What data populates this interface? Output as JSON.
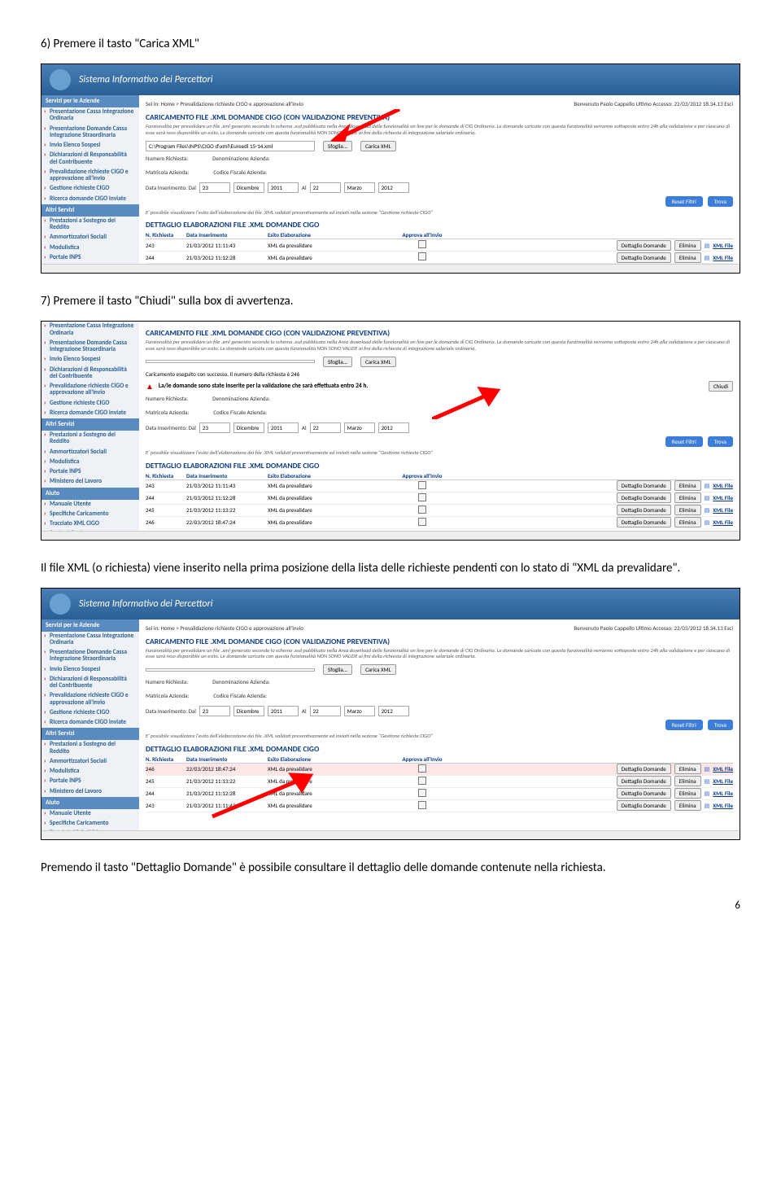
{
  "instr": {
    "six": "6) Premere il tasto \"Carica XML\"",
    "seven": "7) Premere il tasto \"Chiudi\" sulla box di avvertenza.",
    "xml_inserted": "Il file XML (o richiesta) viene inserito nella prima posizione della lista delle richieste pendenti con lo stato di \"XML da prevalidare\".",
    "dettaglio": "Premendo il tasto \"Dettaglio Domande\" è possibile consultare il dettaglio delle domande contenute nella richiesta."
  },
  "app": {
    "banner_title": "Sistema Informativo dei Percettori",
    "breadcrumb_left": "Sei in: Home > Prevalidazione richieste CIGO e approvazione all'invio",
    "breadcrumb_right": "Benvenuto Paolo Cappello   Ultimo Accesso: 22/03/2012 18.34.13   Esci",
    "section_caricamento": "CARICAMENTO FILE .XML DOMANDE CIGO (CON VALIDAZIONE PREVENTIVA)",
    "desc": "Funzionalità per prevalidare un file .xml generato secondo lo schema .xsd pubblicato nella Area download delle funzionalità on line per le domande di CIG Ordinaria. Le domande caricate con questa funzionalità verranno sottoposte entro 24h alla validazione e per ciascuna di esse sarà reso disponibile un esito. Le domande caricate con questa funzionalità NON SONO VALIDE ai fini della richiesta di integrazione salariale ordinaria.",
    "file_path": "C:\\Program Files\\INPS\\CIGO d\\xml\\Eureedi 15-14.xml",
    "btn_sfoglia": "Sfoglia...",
    "btn_carica": "Carica XML",
    "success_msg": "Caricamento eseguito con successo. Il numero della richiesta è 246",
    "alert_msg": "La/le domande sono state inserite per la validazione che sarà effettuata entro 24 h.",
    "btn_chiudi": "Chiudi",
    "filter": {
      "numero": "Numero Richiesta:",
      "matricola": "Matricola Azienda:",
      "denom": "Denominazione Azienda:",
      "cf": "Codice Fiscale Azienda:",
      "data_ins": "Data Inserimento: Dal",
      "al": "Al",
      "d1": "23",
      "m1": "Dicembre",
      "y1": "2011",
      "d2": "22",
      "m2": "Marzo",
      "y2": "2012"
    },
    "esito_nota": "E' possibile visualizzare l'esito dell'elaborazione dei file .XML validati preventivamente ed inviati nella sezione \"Gestione richieste CIGO\"",
    "section_dettaglio": "DETTAGLIO ELABORAZIONI FILE .XML DOMANDE CIGO",
    "cols": {
      "n": "N. Richiesta",
      "date": "Data Inserimento",
      "esito": "Esito Elaborazione",
      "approva": "Approva all'Invio"
    },
    "btn_reset": "Reset Filtri",
    "btn_trova": "Trova",
    "btn_dettaglio": "Dettaglio Domande",
    "btn_elimina": "Elimina",
    "xml_file": "XML File",
    "sidebar": {
      "head1": "Servizi per le Aziende",
      "head2": "Altri Servizi",
      "head3": "Aiuto",
      "items1": [
        "Presentazione Cassa Integrazione Ordinaria",
        "Presentazione Domande Cassa Integrazione Straordinaria",
        "Invio Elenco Sospesi",
        "Dichiarazioni di Responsabilità del Contribuente",
        "Prevalidazione richieste CIGO e approvazione all'invio",
        "Gestione richieste CIGO",
        "Ricerca domande CIGO inviate"
      ],
      "items2": [
        "Prestazioni a Sostegno del Reddito",
        "Ammortizzatori Sociali",
        "Modulistica",
        "Portale INPS",
        "Ministero del Lavoro"
      ],
      "items3": [
        "Manuale Utente",
        "Specifiche Caricamento",
        "Tracciato XML CIGO",
        "Contact Center"
      ]
    },
    "rows_s1": [
      {
        "n": "243",
        "date": "21/03/2012 11:11:43",
        "esito": "XML da prevalidare"
      },
      {
        "n": "244",
        "date": "21/03/2012 11:12:28",
        "esito": "XML da prevalidare"
      }
    ],
    "rows_s2": [
      {
        "n": "243",
        "date": "21/03/2012 11:11:43",
        "esito": "XML da prevalidare"
      },
      {
        "n": "244",
        "date": "21/03/2012 11:12:28",
        "esito": "XML da prevalidare"
      },
      {
        "n": "245",
        "date": "21/03/2012 11:13:22",
        "esito": "XML da prevalidare"
      },
      {
        "n": "246",
        "date": "22/03/2012 18:47:24",
        "esito": "XML da prevalidare"
      }
    ],
    "rows_s3": [
      {
        "n": "246",
        "date": "22/03/2012 18:47:24",
        "esito": "XML da prevalidare",
        "hl": true
      },
      {
        "n": "245",
        "date": "21/03/2012 11:13:22",
        "esito": "XML da prevalidare"
      },
      {
        "n": "244",
        "date": "21/03/2012 11:12:28",
        "esito": "XML da prevalidare"
      },
      {
        "n": "243",
        "date": "21/03/2012 11:11:43",
        "esito": "XML da prevalidare"
      }
    ]
  },
  "page_number": "6"
}
